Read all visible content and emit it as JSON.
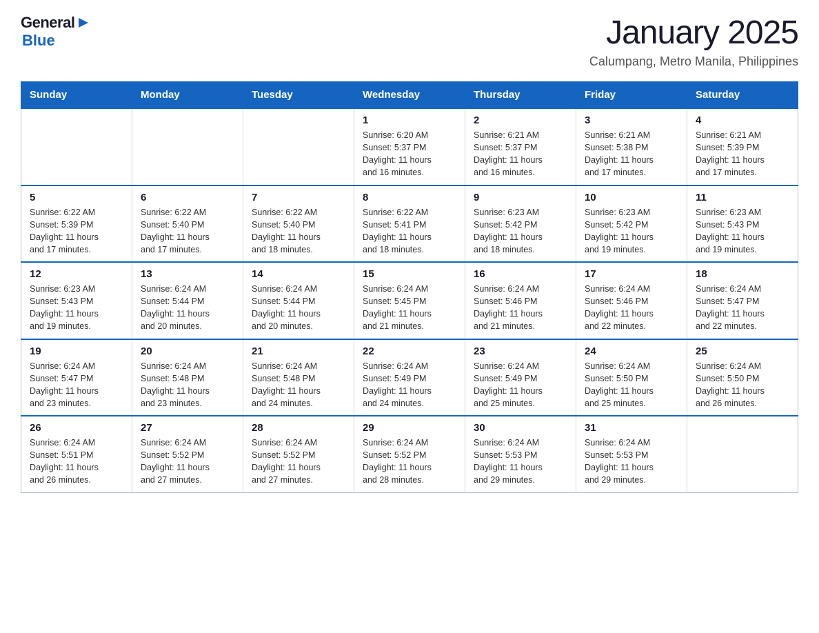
{
  "header": {
    "logo_general": "General",
    "logo_blue": "Blue",
    "title": "January 2025",
    "subtitle": "Calumpang, Metro Manila, Philippines"
  },
  "days_of_week": [
    "Sunday",
    "Monday",
    "Tuesday",
    "Wednesday",
    "Thursday",
    "Friday",
    "Saturday"
  ],
  "weeks": [
    [
      {
        "day": "",
        "info": ""
      },
      {
        "day": "",
        "info": ""
      },
      {
        "day": "",
        "info": ""
      },
      {
        "day": "1",
        "info": "Sunrise: 6:20 AM\nSunset: 5:37 PM\nDaylight: 11 hours\nand 16 minutes."
      },
      {
        "day": "2",
        "info": "Sunrise: 6:21 AM\nSunset: 5:37 PM\nDaylight: 11 hours\nand 16 minutes."
      },
      {
        "day": "3",
        "info": "Sunrise: 6:21 AM\nSunset: 5:38 PM\nDaylight: 11 hours\nand 17 minutes."
      },
      {
        "day": "4",
        "info": "Sunrise: 6:21 AM\nSunset: 5:39 PM\nDaylight: 11 hours\nand 17 minutes."
      }
    ],
    [
      {
        "day": "5",
        "info": "Sunrise: 6:22 AM\nSunset: 5:39 PM\nDaylight: 11 hours\nand 17 minutes."
      },
      {
        "day": "6",
        "info": "Sunrise: 6:22 AM\nSunset: 5:40 PM\nDaylight: 11 hours\nand 17 minutes."
      },
      {
        "day": "7",
        "info": "Sunrise: 6:22 AM\nSunset: 5:40 PM\nDaylight: 11 hours\nand 18 minutes."
      },
      {
        "day": "8",
        "info": "Sunrise: 6:22 AM\nSunset: 5:41 PM\nDaylight: 11 hours\nand 18 minutes."
      },
      {
        "day": "9",
        "info": "Sunrise: 6:23 AM\nSunset: 5:42 PM\nDaylight: 11 hours\nand 18 minutes."
      },
      {
        "day": "10",
        "info": "Sunrise: 6:23 AM\nSunset: 5:42 PM\nDaylight: 11 hours\nand 19 minutes."
      },
      {
        "day": "11",
        "info": "Sunrise: 6:23 AM\nSunset: 5:43 PM\nDaylight: 11 hours\nand 19 minutes."
      }
    ],
    [
      {
        "day": "12",
        "info": "Sunrise: 6:23 AM\nSunset: 5:43 PM\nDaylight: 11 hours\nand 19 minutes."
      },
      {
        "day": "13",
        "info": "Sunrise: 6:24 AM\nSunset: 5:44 PM\nDaylight: 11 hours\nand 20 minutes."
      },
      {
        "day": "14",
        "info": "Sunrise: 6:24 AM\nSunset: 5:44 PM\nDaylight: 11 hours\nand 20 minutes."
      },
      {
        "day": "15",
        "info": "Sunrise: 6:24 AM\nSunset: 5:45 PM\nDaylight: 11 hours\nand 21 minutes."
      },
      {
        "day": "16",
        "info": "Sunrise: 6:24 AM\nSunset: 5:46 PM\nDaylight: 11 hours\nand 21 minutes."
      },
      {
        "day": "17",
        "info": "Sunrise: 6:24 AM\nSunset: 5:46 PM\nDaylight: 11 hours\nand 22 minutes."
      },
      {
        "day": "18",
        "info": "Sunrise: 6:24 AM\nSunset: 5:47 PM\nDaylight: 11 hours\nand 22 minutes."
      }
    ],
    [
      {
        "day": "19",
        "info": "Sunrise: 6:24 AM\nSunset: 5:47 PM\nDaylight: 11 hours\nand 23 minutes."
      },
      {
        "day": "20",
        "info": "Sunrise: 6:24 AM\nSunset: 5:48 PM\nDaylight: 11 hours\nand 23 minutes."
      },
      {
        "day": "21",
        "info": "Sunrise: 6:24 AM\nSunset: 5:48 PM\nDaylight: 11 hours\nand 24 minutes."
      },
      {
        "day": "22",
        "info": "Sunrise: 6:24 AM\nSunset: 5:49 PM\nDaylight: 11 hours\nand 24 minutes."
      },
      {
        "day": "23",
        "info": "Sunrise: 6:24 AM\nSunset: 5:49 PM\nDaylight: 11 hours\nand 25 minutes."
      },
      {
        "day": "24",
        "info": "Sunrise: 6:24 AM\nSunset: 5:50 PM\nDaylight: 11 hours\nand 25 minutes."
      },
      {
        "day": "25",
        "info": "Sunrise: 6:24 AM\nSunset: 5:50 PM\nDaylight: 11 hours\nand 26 minutes."
      }
    ],
    [
      {
        "day": "26",
        "info": "Sunrise: 6:24 AM\nSunset: 5:51 PM\nDaylight: 11 hours\nand 26 minutes."
      },
      {
        "day": "27",
        "info": "Sunrise: 6:24 AM\nSunset: 5:52 PM\nDaylight: 11 hours\nand 27 minutes."
      },
      {
        "day": "28",
        "info": "Sunrise: 6:24 AM\nSunset: 5:52 PM\nDaylight: 11 hours\nand 27 minutes."
      },
      {
        "day": "29",
        "info": "Sunrise: 6:24 AM\nSunset: 5:52 PM\nDaylight: 11 hours\nand 28 minutes."
      },
      {
        "day": "30",
        "info": "Sunrise: 6:24 AM\nSunset: 5:53 PM\nDaylight: 11 hours\nand 29 minutes."
      },
      {
        "day": "31",
        "info": "Sunrise: 6:24 AM\nSunset: 5:53 PM\nDaylight: 11 hours\nand 29 minutes."
      },
      {
        "day": "",
        "info": ""
      }
    ]
  ]
}
